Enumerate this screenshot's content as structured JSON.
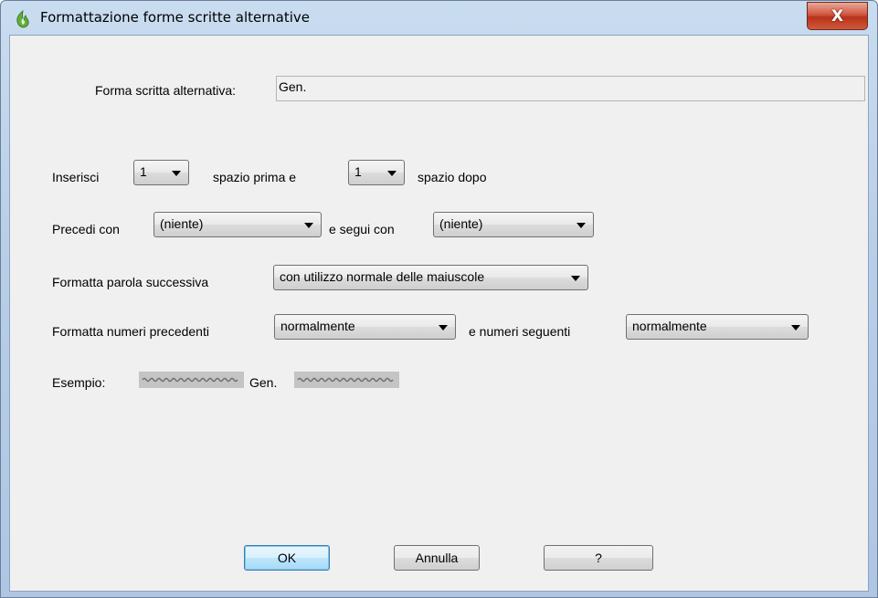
{
  "window": {
    "title": "Formattazione forme scritte alternative",
    "close_label": "X"
  },
  "alt_form": {
    "label": "Forma scritta alternativa:",
    "value": "Gen."
  },
  "spacing": {
    "label_insert": "Inserisci",
    "before_value": "1",
    "label_before": "spazio prima e",
    "after_value": "1",
    "label_after": "spazio dopo"
  },
  "surround": {
    "label_precede": "Precedi con",
    "precede_value": "(niente)",
    "label_follow": "e segui con",
    "follow_value": "(niente)"
  },
  "next_word": {
    "label": "Formatta parola successiva",
    "value": "con utilizzo normale delle maiuscole"
  },
  "numbers": {
    "label_preceding": "Formatta numeri precedenti",
    "preceding_value": "normalmente",
    "label_following": "e numeri seguenti",
    "following_value": "normalmente"
  },
  "example": {
    "label": "Esempio:",
    "text": "Gen."
  },
  "buttons": {
    "ok": "OK",
    "cancel": "Annulla",
    "help": "?"
  },
  "colors": {
    "titlebar": "#b9cfe8",
    "client_bg": "#f0f0f0",
    "close_button": "#c9452c",
    "default_button_border": "#3c7fb1"
  },
  "icons": {
    "app": "flame-icon",
    "close": "close-icon",
    "dropdown": "chevron-down-icon"
  }
}
